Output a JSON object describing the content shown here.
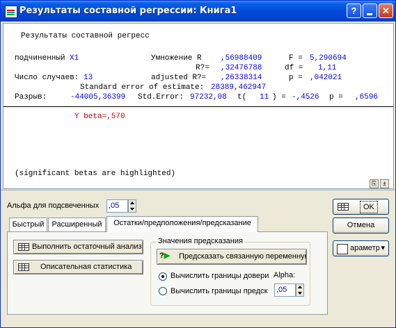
{
  "window": {
    "title": "Результаты составной регрессии: Книга1",
    "help_label": "?",
    "close_label": "✕"
  },
  "results": {
    "heading": "Результаты составной регресс",
    "dependent_label": "подчиненный",
    "dependent_value": "X1",
    "mult_r_label": "Умножение R",
    "mult_r_value": ",56988409",
    "f_label": "F =",
    "f_value": "5,290694",
    "r2_label": "R?=",
    "r2_value": ",32476788",
    "df_label": "df =",
    "df_value": "1,11",
    "cases_label": "Число случаев:",
    "cases_value": "13",
    "adj_label": "adjusted R?=",
    "adj_value": ",26338314",
    "p_label": "p =",
    "p_value": ",042021",
    "se_label": "Standard error of estimate:",
    "se_value": "28389,462947",
    "intercept_label": "Разрыв:",
    "intercept_value": "-44005,36399",
    "std_error_label": "Std.Error:",
    "std_error_value": "97232,08",
    "t_label": "t(",
    "t_df": "11",
    "t_eq": ") =",
    "t_value": "-,4526",
    "p2_label": "p =",
    "p2_value": ",6596",
    "beta_line": "Y beta=,570",
    "note": "(significant betas are highlighted)",
    "highlight_color": "#0000ff",
    "beta_color": "#d00000"
  },
  "controls": {
    "alpha_label": "Альфа для подсвеченных",
    "alpha_value": ",05",
    "ok_label": "OK",
    "cancel_label": "Отмена",
    "options_label": "араметр",
    "tabs": [
      {
        "label": "Быстрый"
      },
      {
        "label": "Расширенный"
      },
      {
        "label": "Остатки/предположения/предсказание"
      }
    ],
    "residual_button": "Выполнить остаточный анализ",
    "descriptive_button": "Описательная статистика",
    "prediction_group": "Значения предсказания",
    "predict_button": "Предсказать связанную переменную",
    "radio_conf": "Вычислить границы довери",
    "radio_pred": "Вычислить границы предск",
    "alpha2_label": "Alpha:",
    "alpha2_value": ",05"
  }
}
